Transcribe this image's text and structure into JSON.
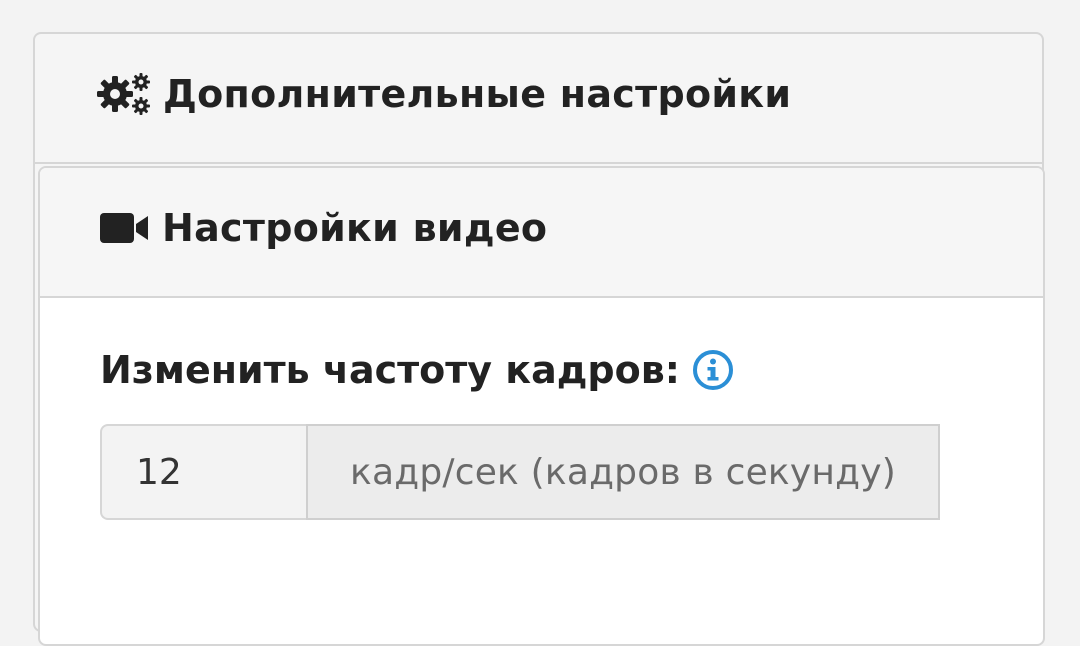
{
  "advanced": {
    "icon": "gears-icon",
    "title": "Дополнительные настройки"
  },
  "video": {
    "icon": "video-camera-icon",
    "title": "Настройки видео"
  },
  "framerate": {
    "label": "Изменить частоту кадров:",
    "info_icon": "info-icon",
    "value": "12",
    "unit": "кадр/сек (кадров в секунду)"
  },
  "colors": {
    "info_accent": "#2b8fd6",
    "text": "#222222",
    "border": "#d6d6d6"
  }
}
